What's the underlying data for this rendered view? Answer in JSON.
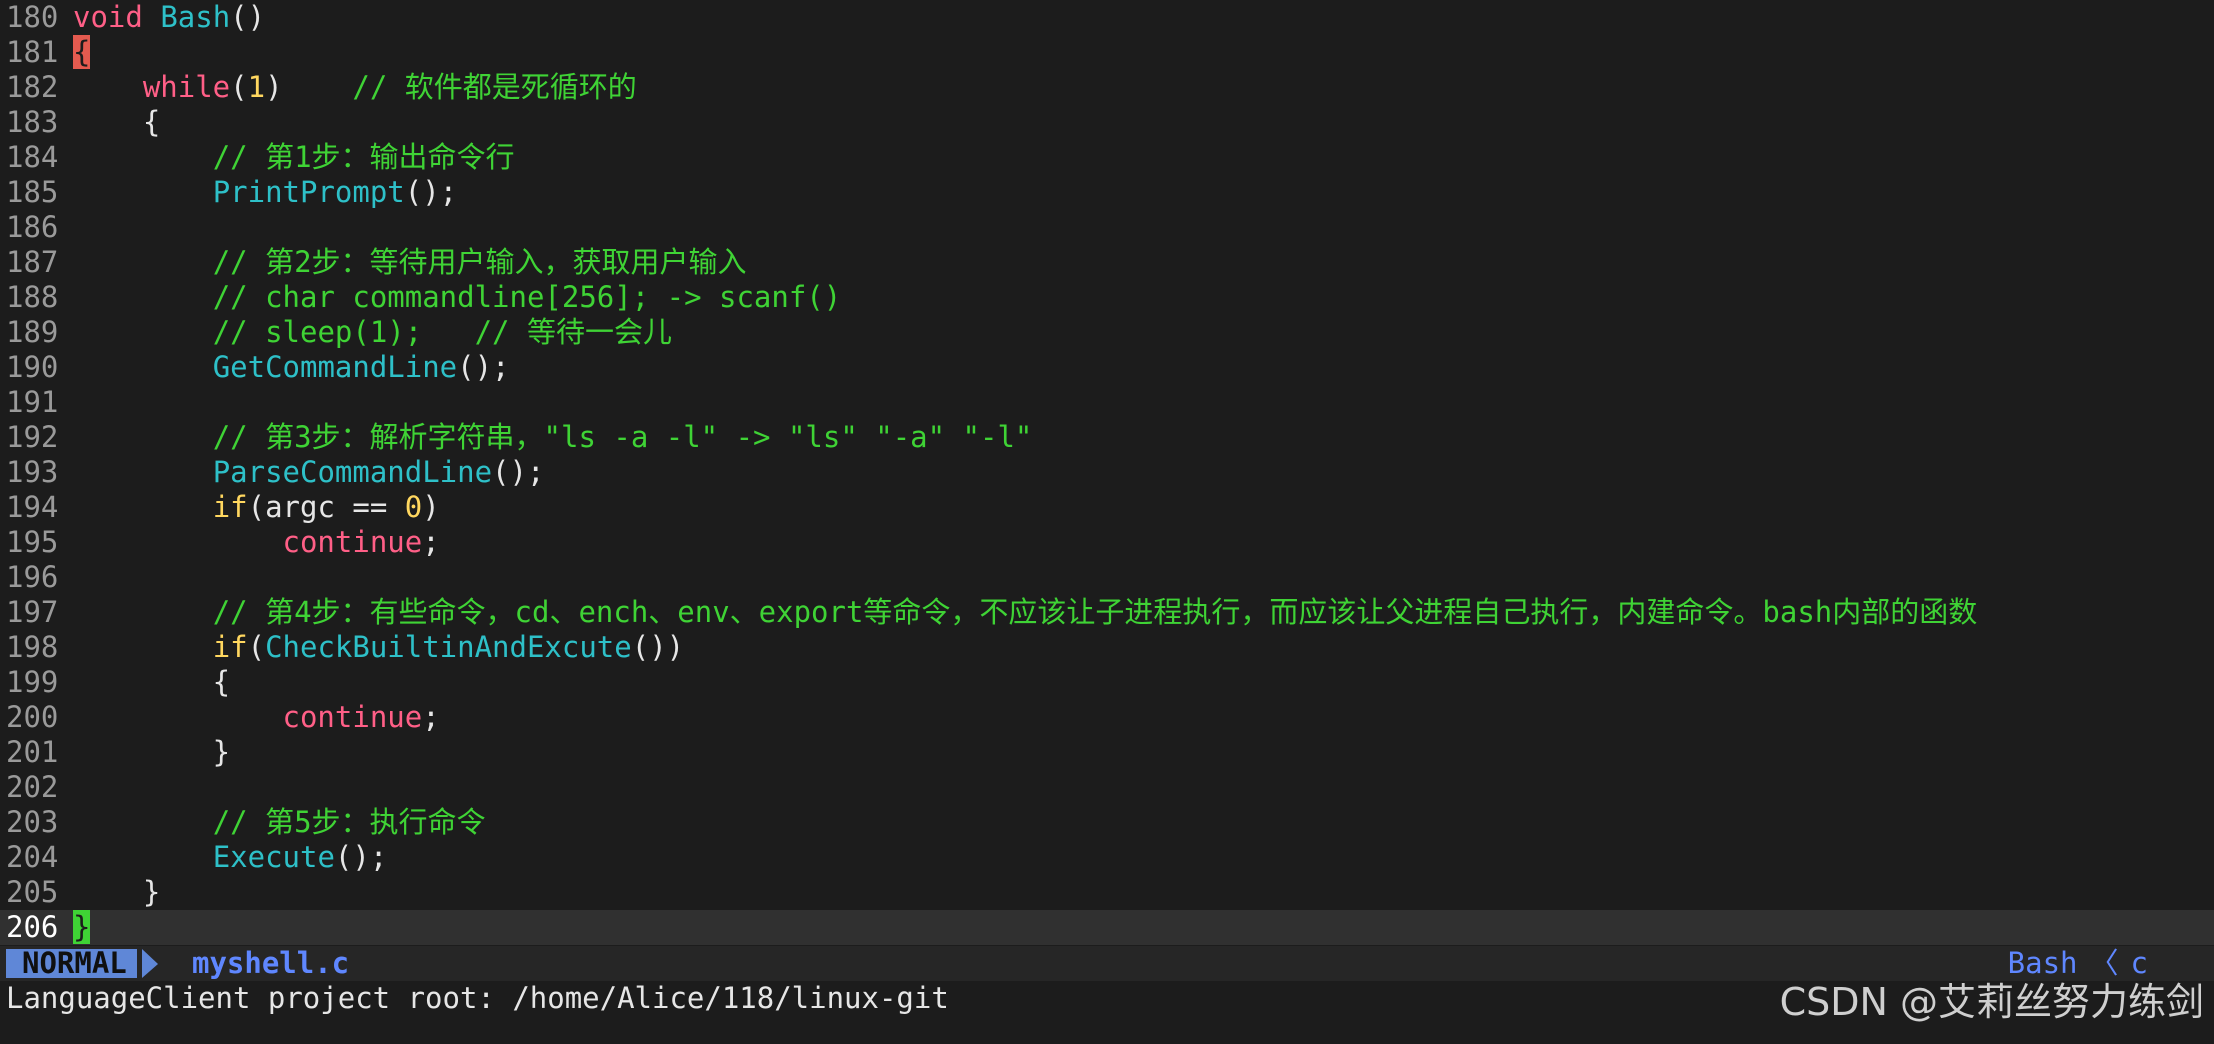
{
  "editor": {
    "lines": [
      {
        "n": "180",
        "tokens": [
          {
            "t": "void ",
            "c": "kw"
          },
          {
            "t": "Bash",
            "c": "fn"
          },
          {
            "t": "()",
            "c": "p"
          }
        ]
      },
      {
        "n": "181",
        "tokens": [
          {
            "t": "{",
            "c": "br-open"
          }
        ]
      },
      {
        "n": "182",
        "tokens": [
          {
            "t": "    ",
            "c": "p"
          },
          {
            "t": "while",
            "c": "kw"
          },
          {
            "t": "(",
            "c": "p"
          },
          {
            "t": "1",
            "c": "num"
          },
          {
            "t": ")    ",
            "c": "p"
          },
          {
            "t": "// 软件都是死循环的",
            "c": "cm"
          }
        ]
      },
      {
        "n": "183",
        "tokens": [
          {
            "t": "    {",
            "c": "p"
          }
        ]
      },
      {
        "n": "184",
        "tokens": [
          {
            "t": "        ",
            "c": "p"
          },
          {
            "t": "// 第1步：输出命令行",
            "c": "cm"
          }
        ]
      },
      {
        "n": "185",
        "tokens": [
          {
            "t": "        ",
            "c": "p"
          },
          {
            "t": "PrintPrompt",
            "c": "fn"
          },
          {
            "t": "();",
            "c": "p"
          }
        ]
      },
      {
        "n": "186",
        "tokens": []
      },
      {
        "n": "187",
        "tokens": [
          {
            "t": "        ",
            "c": "p"
          },
          {
            "t": "// 第2步：等待用户输入，获取用户输入",
            "c": "cm"
          }
        ]
      },
      {
        "n": "188",
        "tokens": [
          {
            "t": "        ",
            "c": "p"
          },
          {
            "t": "// char commandline[256]; -> scanf()",
            "c": "cm"
          }
        ]
      },
      {
        "n": "189",
        "tokens": [
          {
            "t": "        ",
            "c": "p"
          },
          {
            "t": "// sleep(1);   // 等待一会儿",
            "c": "cm"
          }
        ]
      },
      {
        "n": "190",
        "tokens": [
          {
            "t": "        ",
            "c": "p"
          },
          {
            "t": "GetCommandLine",
            "c": "fn"
          },
          {
            "t": "();",
            "c": "p"
          }
        ]
      },
      {
        "n": "191",
        "tokens": []
      },
      {
        "n": "192",
        "tokens": [
          {
            "t": "        ",
            "c": "p"
          },
          {
            "t": "// 第3步：解析字符串，\"ls -a -l\" -> \"ls\" \"-a\" \"-l\"",
            "c": "cm"
          }
        ]
      },
      {
        "n": "193",
        "tokens": [
          {
            "t": "        ",
            "c": "p"
          },
          {
            "t": "ParseCommandLine",
            "c": "fn"
          },
          {
            "t": "();",
            "c": "p"
          }
        ]
      },
      {
        "n": "194",
        "tokens": [
          {
            "t": "        ",
            "c": "p"
          },
          {
            "t": "if",
            "c": "num"
          },
          {
            "t": "(argc == ",
            "c": "p"
          },
          {
            "t": "0",
            "c": "num"
          },
          {
            "t": ")",
            "c": "p"
          }
        ]
      },
      {
        "n": "195",
        "tokens": [
          {
            "t": "            ",
            "c": "p"
          },
          {
            "t": "continue",
            "c": "kw"
          },
          {
            "t": ";",
            "c": "p"
          }
        ]
      },
      {
        "n": "196",
        "tokens": []
      },
      {
        "n": "197",
        "tokens": [
          {
            "t": "        ",
            "c": "p"
          },
          {
            "t": "// 第4步：有些命令，cd、ench、env、export等命令，不应该让子进程执行，而应该让父进程自己执行，内建命令。bash内部的函数",
            "c": "cm"
          }
        ]
      },
      {
        "n": "198",
        "tokens": [
          {
            "t": "        ",
            "c": "p"
          },
          {
            "t": "if",
            "c": "num"
          },
          {
            "t": "(",
            "c": "p"
          },
          {
            "t": "CheckBuiltinAndExcute",
            "c": "fn"
          },
          {
            "t": "())",
            "c": "p"
          }
        ]
      },
      {
        "n": "199",
        "tokens": [
          {
            "t": "        {",
            "c": "p"
          }
        ]
      },
      {
        "n": "200",
        "tokens": [
          {
            "t": "            ",
            "c": "p"
          },
          {
            "t": "continue",
            "c": "kw"
          },
          {
            "t": ";",
            "c": "p"
          }
        ]
      },
      {
        "n": "201",
        "tokens": [
          {
            "t": "        }",
            "c": "p"
          }
        ]
      },
      {
        "n": "202",
        "tokens": []
      },
      {
        "n": "203",
        "tokens": [
          {
            "t": "        ",
            "c": "p"
          },
          {
            "t": "// 第5步：执行命令",
            "c": "cm"
          }
        ]
      },
      {
        "n": "204",
        "tokens": [
          {
            "t": "        ",
            "c": "p"
          },
          {
            "t": "Execute",
            "c": "fn"
          },
          {
            "t": "();",
            "c": "p"
          }
        ]
      },
      {
        "n": "205",
        "tokens": [
          {
            "t": "    }",
            "c": "p"
          }
        ]
      },
      {
        "n": "206",
        "tokens": [
          {
            "t": "}",
            "c": "br-close"
          }
        ],
        "current": true
      }
    ]
  },
  "statusline": {
    "mode": "NORMAL",
    "filename": "myshell.c",
    "function": "Bash",
    "separator": "〈",
    "filetype": "c"
  },
  "cmdline": {
    "message": "LanguageClient project root: /home/Alice/118/linux-git"
  },
  "watermark": {
    "text": "CSDN @艾莉丝努力练剑"
  }
}
